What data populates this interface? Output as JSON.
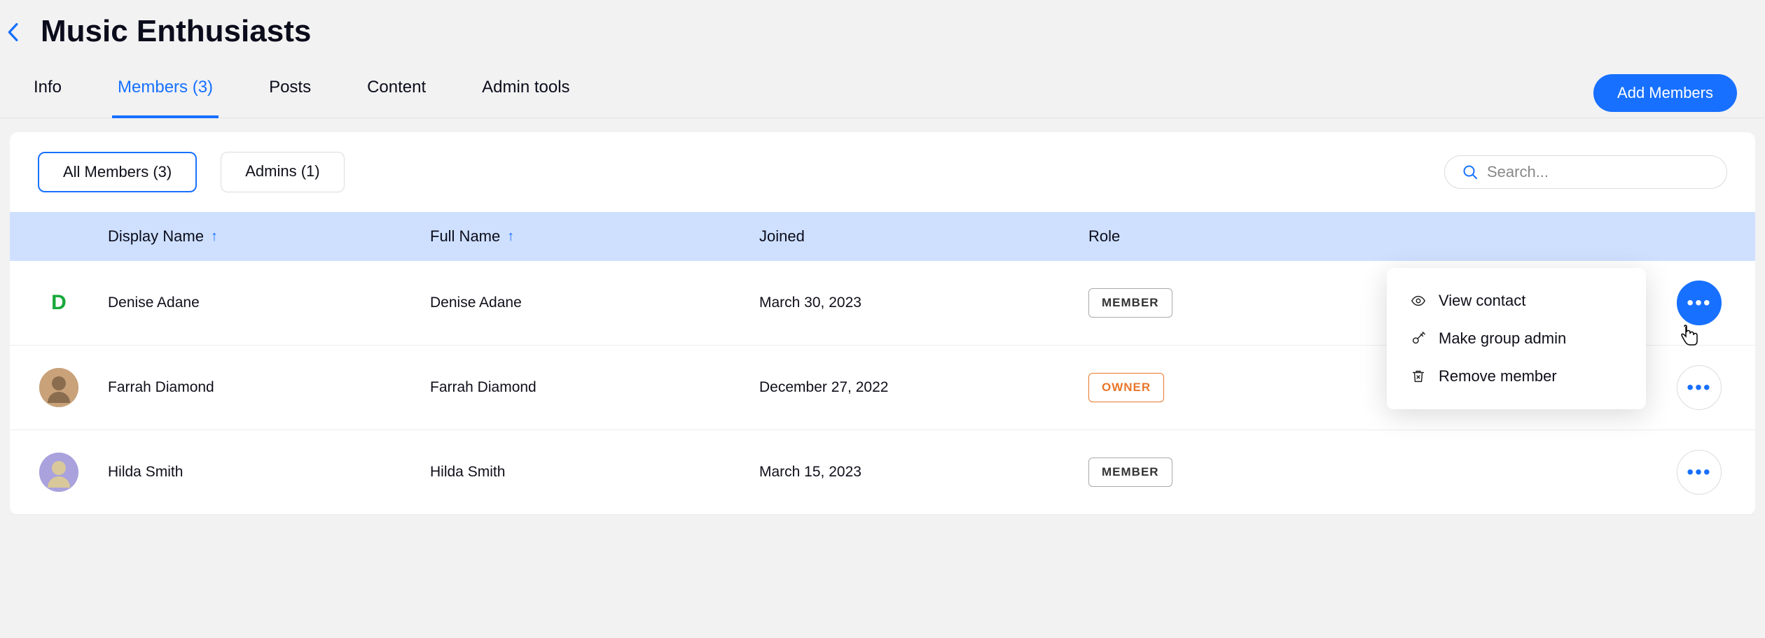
{
  "header": {
    "title": "Music Enthusiasts"
  },
  "tabs": {
    "info": "Info",
    "members": "Members (3)",
    "posts": "Posts",
    "content": "Content",
    "admin_tools": "Admin tools"
  },
  "buttons": {
    "add_members": "Add Members"
  },
  "filters": {
    "all_members": "All Members (3)",
    "admins": "Admins (1)"
  },
  "search": {
    "placeholder": "Search..."
  },
  "table": {
    "headers": {
      "display_name": "Display Name",
      "full_name": "Full Name",
      "joined": "Joined",
      "role": "Role"
    },
    "rows": [
      {
        "avatar_letter": "D",
        "avatar_color": "#17a83a",
        "avatar_bg": "#ffffff",
        "display_name": "Denise Adane",
        "full_name": "Denise Adane",
        "joined": "March 30, 2023",
        "role": "MEMBER",
        "role_type": "member"
      },
      {
        "avatar_letter": "",
        "avatar_color": "#ffffff",
        "avatar_bg": "#c9a27a",
        "display_name": "Farrah Diamond",
        "full_name": "Farrah Diamond",
        "joined": "December 27, 2022",
        "role": "OWNER",
        "role_type": "owner"
      },
      {
        "avatar_letter": "",
        "avatar_color": "#ffffff",
        "avatar_bg": "#a9a2dd",
        "display_name": "Hilda Smith",
        "full_name": "Hilda Smith",
        "joined": "March 15, 2023",
        "role": "MEMBER",
        "role_type": "member"
      }
    ]
  },
  "menu": {
    "view_contact": "View contact",
    "make_admin": "Make group admin",
    "remove_member": "Remove member"
  }
}
